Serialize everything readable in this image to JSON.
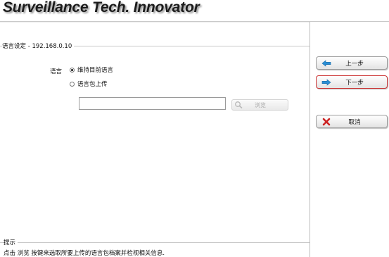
{
  "header": {
    "brand": "Surveillance Tech. Innovator"
  },
  "section": {
    "title": "语言设定 - 192.168.0.10"
  },
  "language": {
    "label": "语言",
    "options": [
      {
        "label": "维持目前语言",
        "selected": true
      },
      {
        "label": "语言包上传",
        "selected": false
      }
    ]
  },
  "upload": {
    "file_value": "",
    "browse_label": "浏览",
    "browse_icon": "magnifier-icon"
  },
  "hint": {
    "title": "提示",
    "text": "点击 浏览 按键来选取所要上传的语言包档案并检视相关信息."
  },
  "nav": {
    "prev_label": "上一步",
    "next_label": "下一步",
    "cancel_label": "取消",
    "active_button": "next"
  },
  "colors": {
    "accent_arrow": "#2b8fd6",
    "cancel_icon": "#cc2222",
    "active_border": "#cc3333"
  }
}
